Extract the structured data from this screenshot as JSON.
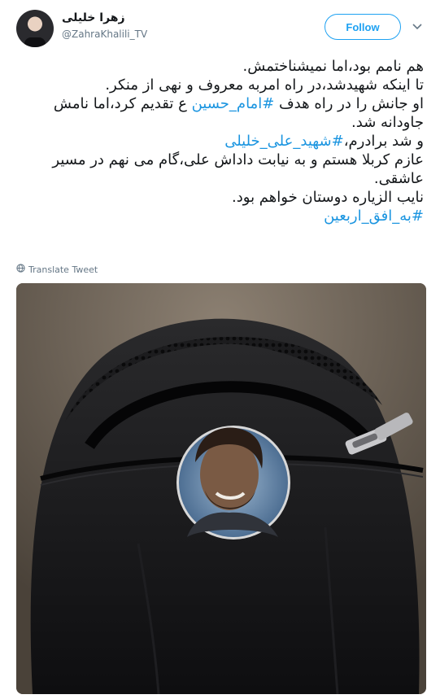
{
  "author": {
    "display_name": "زهرا خلیلی",
    "handle": "@ZahraKhalili_TV"
  },
  "actions": {
    "follow_label": "Follow"
  },
  "tweet": {
    "line1": "هم نامم بود،اما نمیشناختمش.",
    "line2": "تا اینکه شهیدشد،در راه امربه معروف و نهی از منکر.",
    "line3_pre": "او جانش را در راه هدف ",
    "line3_tag": "#امام_حسین",
    "line3_post": " ع تقدیم کرد،اما نامش",
    "line4": "جاودانه شد.",
    "line5_pre": "و شد برادرم،",
    "line5_tag": "#شهید_علی_خلیلی",
    "line6": "عازم کربلا هستم و به نیابت داداش علی،گام می نهم در مسیر",
    "line7": "عاشقی.",
    "line8": "نایب الزیاره دوستان خواهم بود.",
    "line9_tag": "#به_افق_اربعین"
  },
  "translate_label": "Translate Tweet",
  "icons": {
    "chevron": "chevron-down-icon",
    "globe": "globe-icon"
  },
  "colors": {
    "accent": "#1da1f2",
    "hashtag": "#1b95e0",
    "muted": "#657786"
  }
}
